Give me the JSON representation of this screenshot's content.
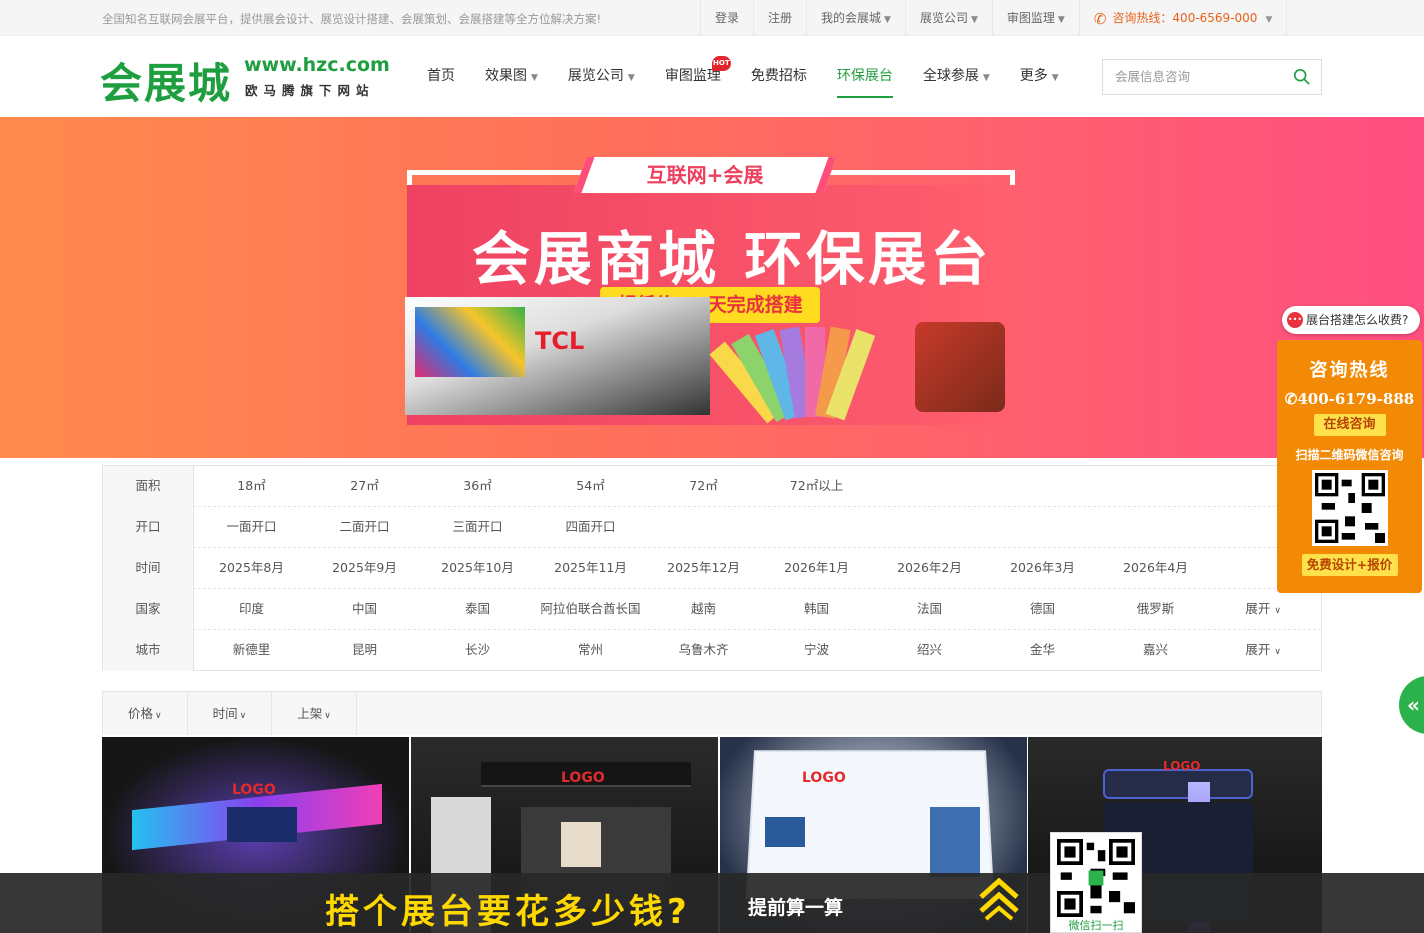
{
  "topbar": {
    "slogan": "全国知名互联网会展平台，提供展会设计、展览设计搭建、会展策划、会展搭建等全方位解决方案!",
    "links": [
      {
        "label": "登录",
        "dropdown": false
      },
      {
        "label": "注册",
        "dropdown": false
      },
      {
        "label": "我的会展城",
        "dropdown": true
      },
      {
        "label": "展览公司",
        "dropdown": true
      },
      {
        "label": "审图监理",
        "dropdown": true
      }
    ],
    "hotline": "咨询热线：400-6569-000"
  },
  "logo": {
    "cn": "会展城",
    "url": "www.hzc.com",
    "sub": "欧马腾旗下网站"
  },
  "nav": {
    "items": [
      {
        "label": "首页",
        "dropdown": false
      },
      {
        "label": "效果图",
        "dropdown": true
      },
      {
        "label": "展览公司",
        "dropdown": true
      },
      {
        "label": "审图监理",
        "dropdown": false,
        "badge": "HOT"
      },
      {
        "label": "免费招标",
        "dropdown": false
      },
      {
        "label": "环保展台",
        "dropdown": false,
        "active": true
      },
      {
        "label": "全球参展",
        "dropdown": true
      },
      {
        "label": "更多",
        "dropdown": true
      }
    ],
    "search_placeholder": "会展信息咨询"
  },
  "banner": {
    "tag": "互联网+会展",
    "title": "会展商城  环保展台",
    "badge": "超低价 | 7天完成搭建",
    "booth_logo": "TCL"
  },
  "filters": [
    {
      "key": "面积",
      "values": [
        "18㎡",
        "27㎡",
        "36㎡",
        "54㎡",
        "72㎡",
        "72㎡以上"
      ],
      "expand": ""
    },
    {
      "key": "开口",
      "values": [
        "一面开口",
        "二面开口",
        "三面开口",
        "四面开口"
      ],
      "expand": ""
    },
    {
      "key": "时间",
      "values": [
        "2025年8月",
        "2025年9月",
        "2025年10月",
        "2025年11月",
        "2025年12月",
        "2026年1月",
        "2026年2月",
        "2026年3月",
        "2026年4月"
      ],
      "expand": ""
    },
    {
      "key": "国家",
      "values": [
        "印度",
        "中国",
        "泰国",
        "阿拉伯联合酋长国",
        "越南",
        "韩国",
        "法国",
        "德国",
        "俄罗斯"
      ],
      "expand": "展开"
    },
    {
      "key": "城市",
      "values": [
        "新德里",
        "昆明",
        "长沙",
        "常州",
        "乌鲁木齐",
        "宁波",
        "绍兴",
        "金华",
        "嘉兴"
      ],
      "expand": "展开"
    }
  ],
  "sort": [
    {
      "label": "价格"
    },
    {
      "label": "时间"
    },
    {
      "label": "上架"
    }
  ],
  "products": [
    {
      "logo": "LOGO"
    },
    {
      "logo": "LOGO"
    },
    {
      "logo": "LOGO"
    },
    {
      "logo": "LOGO"
    }
  ],
  "bottom_ad": {
    "big": "搭个展台要花多少钱?",
    "small": "提前算一算",
    "qr_caption": "微信扫一扫"
  },
  "side": {
    "ask": "展台搭建怎么收费?",
    "title": "咨询热线",
    "phone": "400-6179-888",
    "online": "在线咨询",
    "scan": "扫描二维码微信咨询",
    "free": "免费设计+报价"
  },
  "colors": {
    "brand": "#1f9e3f",
    "accent": "#e8631b",
    "side": "#f28a06",
    "banner_left": "#ff8a4c",
    "banner_right": "#ff4f82"
  }
}
